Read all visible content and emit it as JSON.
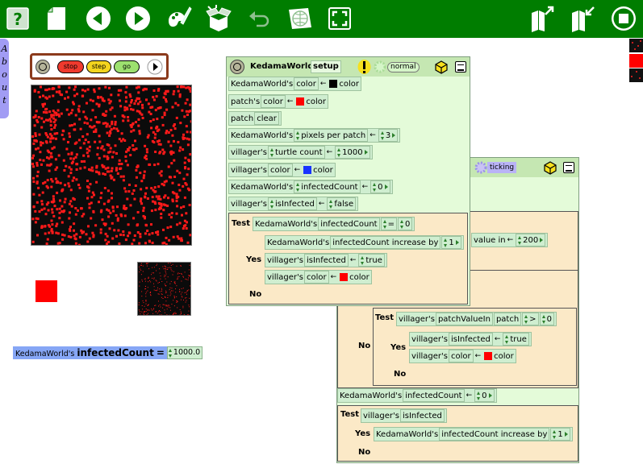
{
  "flap": {
    "about_letters": [
      "A",
      "b",
      "o",
      "u",
      "t"
    ]
  },
  "controls": {
    "stop": "stop",
    "step": "step",
    "go": "go"
  },
  "watcher": {
    "object": "KedamaWorld's",
    "slot": "infectedCount",
    "op": "=",
    "value": "1000.0"
  },
  "setup": {
    "title": "KedamaWorld",
    "name": "setup",
    "mode": "normal",
    "lines": [
      {
        "obj": "KedamaWorld's",
        "slot": "color",
        "arrow": "←",
        "val": "color",
        "swatch": "#000000"
      },
      {
        "obj": "patch's",
        "slot": "color",
        "arrow": "←",
        "val": "color",
        "swatch": "#ff0000"
      },
      {
        "obj": "patch",
        "cmd": "clear"
      },
      {
        "obj": "KedamaWorld's",
        "slot": "pixels per patch",
        "arrow": "←",
        "val": "3"
      },
      {
        "obj": "villager's",
        "slot": "turtle count",
        "arrow": "←",
        "val": "1000"
      },
      {
        "obj": "villager's",
        "slot": "color",
        "arrow": "←",
        "val": "color",
        "swatch": "#1833ff"
      },
      {
        "obj": "KedamaWorld's",
        "slot": "infectedCount",
        "arrow": "←",
        "val": "0"
      },
      {
        "obj": "villager's",
        "slot": "isInfected",
        "arrow": "←",
        "val": "false"
      }
    ],
    "test": {
      "label": "Test",
      "obj": "KedamaWorld's",
      "slot": "infectedCount",
      "op": "=",
      "val": "0",
      "yes_label": "Yes",
      "no_label": "No",
      "yes": [
        {
          "obj": "KedamaWorld's",
          "slot": "infectedCount increase by",
          "val": "1"
        },
        {
          "obj": "villager's",
          "slot": "isInfected",
          "arrow": "←",
          "val": "true"
        },
        {
          "obj": "villager's",
          "slot": "color",
          "arrow": "←",
          "val": "color",
          "swatch": "#ff0000"
        }
      ]
    }
  },
  "ticking": {
    "mode": "ticking",
    "partial": {
      "text": "value in",
      "arrow": "←",
      "val": "200"
    },
    "no_label": "No",
    "inner": {
      "label": "Test",
      "obj": "villager's",
      "slot": "patchValueIn",
      "sub": "patch",
      "op": ">",
      "val": "0",
      "yes_label": "Yes",
      "no_label": "No",
      "yes": [
        {
          "obj": "villager's",
          "slot": "isInfected",
          "arrow": "←",
          "val": "true"
        },
        {
          "obj": "villager's",
          "slot": "color",
          "arrow": "←",
          "val": "color",
          "swatch": "#ff0000"
        }
      ]
    },
    "assign": {
      "obj": "KedamaWorld's",
      "slot": "infectedCount",
      "arrow": "←",
      "val": "0"
    },
    "test2": {
      "label": "Test",
      "obj": "villager's",
      "slot": "isInfected",
      "yes_label": "Yes",
      "no_label": "No",
      "yes": {
        "obj": "KedamaWorld's",
        "slot": "infectedCount increase by",
        "val": "1"
      }
    }
  },
  "colors": {
    "toolbar": "#007d00",
    "tile": "#cfeed0",
    "script_bg": "#e4fbd9",
    "test_bg": "#fbe9c7",
    "dots": "#ff1a1a"
  }
}
